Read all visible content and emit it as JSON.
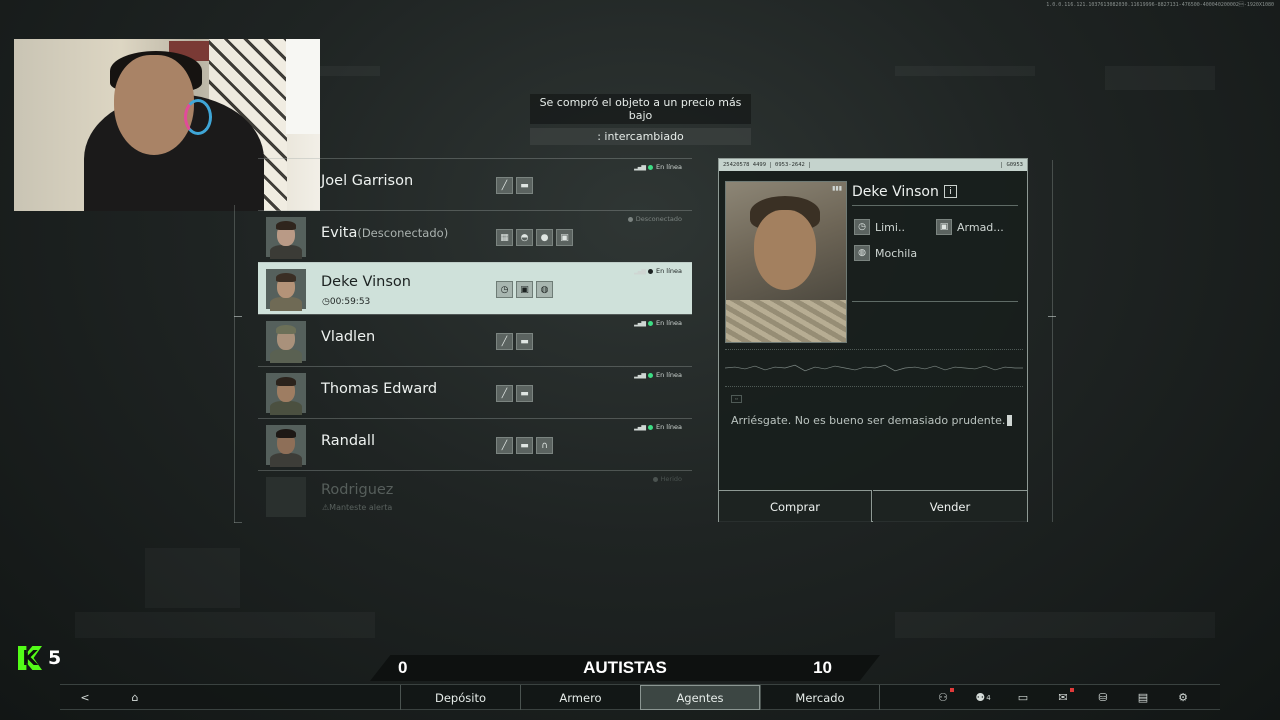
{
  "version_text": "1.0.0.116.121.1037613082030.11619996-8827131-476500-400040200002\u0018-1920X1080",
  "notification": {
    "line1": "Se compró el objeto a un precio más bajo",
    "line2": ": intercambiado"
  },
  "agents": [
    {
      "name": "Joel Garrison",
      "status": "En línea",
      "online": true
    },
    {
      "name": "Evita",
      "sub": "(Desconectado)",
      "status": "Desconectado",
      "online": false
    },
    {
      "name": "Deke Vinson",
      "timer": "00:59:53",
      "status": "En línea",
      "online": true,
      "selected": true
    },
    {
      "name": "Vladlen",
      "status": "En línea",
      "online": true
    },
    {
      "name": "Thomas Edward",
      "status": "En línea",
      "online": true
    },
    {
      "name": "Randall",
      "status": "En línea",
      "online": true
    },
    {
      "name": "Rodriguez",
      "warning": "Manteste alerta",
      "status": "Herido",
      "online": false
    }
  ],
  "detail": {
    "header_left": "25420578 4499",
    "header_mid": "0953-2642",
    "header_right": "G0953",
    "name": "Deke Vinson",
    "info_icon": "i",
    "traits": [
      {
        "icon": "clock-icon",
        "label": "Limi.."
      },
      {
        "icon": "armor-icon",
        "label": "Armad..."
      },
      {
        "icon": "backpack-icon",
        "label": "Mochila"
      }
    ],
    "quote": "Arriésgate. No es bueno ser demasiado prudente.",
    "buy_label": "Comprar",
    "sell_label": "Vender"
  },
  "kbadge": {
    "letter": "K",
    "value": "5"
  },
  "score": {
    "left": "0",
    "team": "AUTISTAS",
    "right": "10"
  },
  "nav": {
    "tabs": [
      {
        "label": "Depósito",
        "active": false
      },
      {
        "label": "Armero",
        "active": false
      },
      {
        "label": "Agentes",
        "active": true
      },
      {
        "label": "Mercado",
        "active": false
      }
    ],
    "icon_count": "4"
  },
  "colors": {
    "online_dot": "#3ddc84",
    "selected_row": "#cfe1da",
    "kick_green": "#53fc18",
    "alert_red": "#e03a3a"
  }
}
